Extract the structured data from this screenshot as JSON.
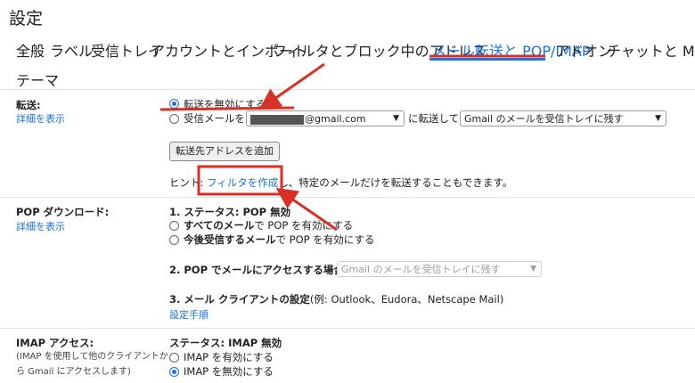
{
  "page": {
    "title": "設定"
  },
  "tabs": [
    {
      "label": "全般"
    },
    {
      "label": "ラベル"
    },
    {
      "label": "受信トレイ"
    },
    {
      "label": "アカウントとインポート"
    },
    {
      "label": "フィルタとブロック中のアドレス"
    },
    {
      "label": "メール転送と POP/IMAP",
      "active": true
    },
    {
      "label": "アドオン"
    },
    {
      "label": "チャットと Meet"
    },
    {
      "label": "テーマ"
    }
  ],
  "forwarding": {
    "label": "転送:",
    "learn_more": "詳細を表示",
    "option_disable": "転送を無効にする",
    "option_forward_prefix": "受信メールを",
    "email_value": "@gmail.com",
    "forward_mid": "に転送して",
    "action_value": "Gmail のメールを受信トレイに残す",
    "add_button": "転送先アドレスを追加",
    "hint_prefix": "ヒント: ",
    "hint_link": "フィルタを作成",
    "hint_suffix": "し、特定のメールだけを転送することもできます。"
  },
  "pop": {
    "label": "POP ダウンロード:",
    "learn_more": "詳細を表示",
    "status": "1. ステータス: POP 無効",
    "opt_all_bold": "すべてのメール",
    "opt_all_rest": "で POP を有効にする",
    "opt_future_bold": "今後受信するメール",
    "opt_future_rest": "で POP を有効にする",
    "access_label": "2. POP でメールにアクセスする場合",
    "access_value": "Gmail のメールを受信トレイに残す",
    "client_label": "3. メール クライアントの設定",
    "client_examples": "(例: Outlook、Eudora、Netscape Mail)",
    "setup_link": "設定手順"
  },
  "imap": {
    "label": "IMAP アクセス:",
    "desc_line1": "(IMAP を使用して他のクライアントか",
    "desc_line2": "ら Gmail にアクセスします)",
    "status": "ステータス: IMAP 無効",
    "opt_enable": "IMAP を有効にする",
    "opt_disable": "IMAP を無効にする"
  },
  "colors": {
    "accent": "#1a73e8",
    "annotation": "#d93025"
  }
}
